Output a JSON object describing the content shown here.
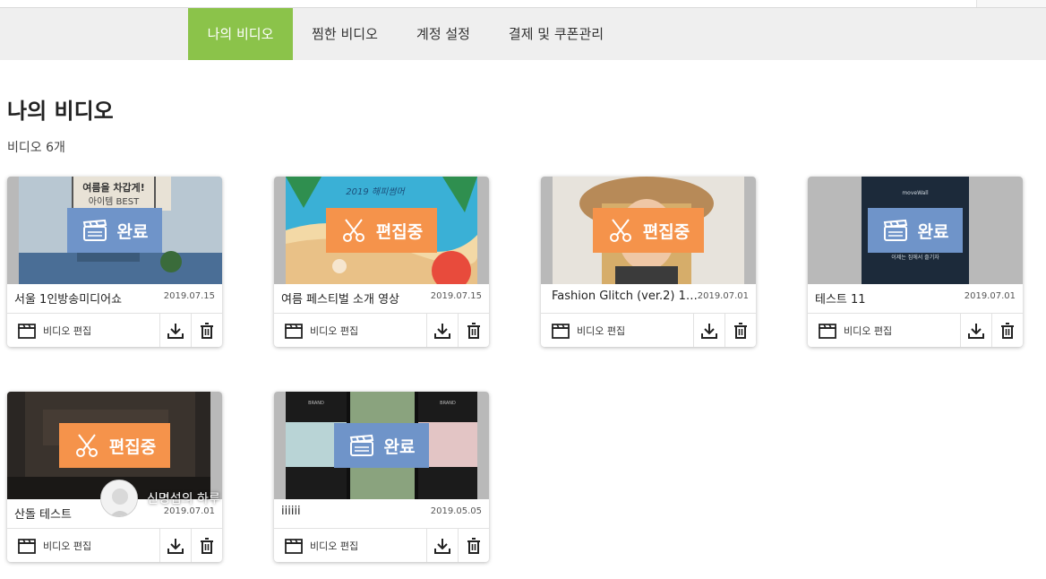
{
  "nav": {
    "tabs": [
      {
        "label": "나의 비디오",
        "active": true
      },
      {
        "label": "찜한 비디오",
        "active": false
      },
      {
        "label": "계정 설정",
        "active": false
      },
      {
        "label": "결제 및 쿠폰관리",
        "active": false
      }
    ]
  },
  "page": {
    "title": "나의 비디오",
    "count_label": "비디오 6개"
  },
  "colors": {
    "active_tab": "#8bc34a",
    "badge_done": "#6f94c9",
    "badge_editing": "#f5934b"
  },
  "cards": [
    {
      "title": "서울 1인방송미디어쇼",
      "date": "2019.07.15",
      "status": "완료",
      "status_icon": "clapperboard-icon",
      "edit_label": "비디오 편집",
      "thumb_text_1": "여름을 차갑게!",
      "thumb_text_2": "아이템 BEST"
    },
    {
      "title": "여름 페스티벌 소개 영상",
      "date": "2019.07.15",
      "status": "편집중",
      "status_icon": "scissors-icon",
      "edit_label": "비디오 편집",
      "thumb_text_1": "2019 해피썸머"
    },
    {
      "title": "Fashion Glitch (ver.2) 1…",
      "date": "2019.07.01",
      "status": "편집중",
      "status_icon": "scissors-icon",
      "edit_label": "비디오 편집"
    },
    {
      "title": "테스트 11",
      "date": "2019.07.01",
      "status": "완료",
      "status_icon": "clapperboard-icon",
      "edit_label": "비디오 편집",
      "thumb_text_1": "moveWall",
      "thumb_text_2": "이제는 집에서 즐기자"
    },
    {
      "title": "산돌 테스트",
      "date": "2019.07.01",
      "status": "편집중",
      "status_icon": "scissors-icon",
      "edit_label": "비디오 편집"
    },
    {
      "title": "iiiiii",
      "date": "2019.05.05",
      "status": "완료",
      "status_icon": "clapperboard-icon",
      "edit_label": "비디오 편집",
      "thumb_text_1": "BRAND"
    }
  ],
  "profile": {
    "name": "신명섭의 하루"
  }
}
